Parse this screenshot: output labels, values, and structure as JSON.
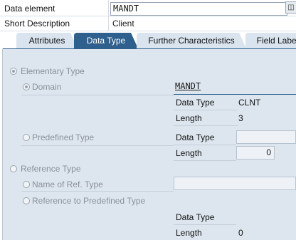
{
  "header": {
    "data_element_label": "Data element",
    "data_element_value": "MANDT",
    "short_description_label": "Short Description",
    "short_description_value": "Client"
  },
  "tabs": [
    {
      "label": "Attributes",
      "active": false
    },
    {
      "label": "Data Type",
      "active": true
    },
    {
      "label": "Further Characteristics",
      "active": false
    },
    {
      "label": "Field Label",
      "active": false
    }
  ],
  "data_type_tab": {
    "elementary_type_label": "Elementary Type",
    "domain": {
      "label": "Domain",
      "value": "MANDT",
      "data_type_label": "Data Type",
      "data_type_value": "CLNT",
      "length_label": "Length",
      "length_value": "3"
    },
    "predefined": {
      "label": "Predefined Type",
      "data_type_label": "Data Type",
      "data_type_value": "",
      "length_label": "Length",
      "length_value": "0"
    },
    "reference_type_label": "Reference Type",
    "name_of_ref_type_label": "Name of Ref. Type",
    "name_of_ref_type_value": "",
    "reference_predefined": {
      "label": "Reference to Predefined Type",
      "data_type_label": "Data Type",
      "data_type_value": "",
      "length_label": "Length",
      "length_value": "0"
    }
  },
  "colors": {
    "active_tab": "#2e5f8d",
    "inactive_tab": "#d9e4ee",
    "panel_bg": "#dde6ee"
  }
}
